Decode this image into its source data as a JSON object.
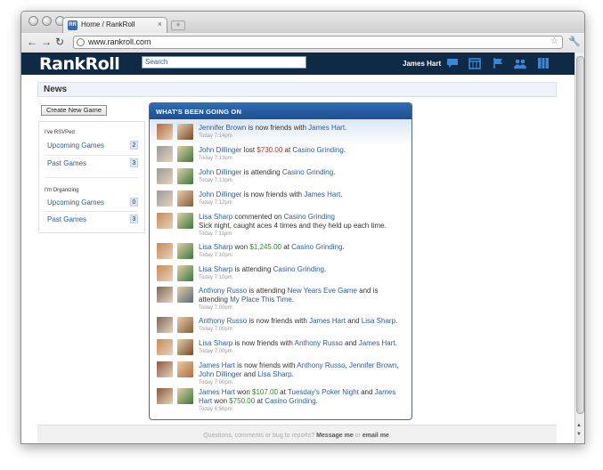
{
  "browser": {
    "tab_title": "Home / RankRoll",
    "tab_favicon": "RR",
    "address": "www.rankroll.com"
  },
  "site": {
    "logo": "RankRoll",
    "search_placeholder": "Search",
    "user_name": "James Hart",
    "header_icons": [
      "chat-bubble-icon",
      "calendar-icon",
      "flag-icon",
      "people-icon",
      "grid-icon"
    ],
    "brand_colors": {
      "header": "#0f2a45",
      "link": "#2a5d99",
      "negative": "#cc2b2b",
      "positive": "#2f8a2f"
    }
  },
  "page": {
    "title": "News",
    "new_game_label": "Create New Game"
  },
  "sidebar": {
    "rsvped": {
      "heading": "I've RSVPed",
      "items": [
        {
          "label": "Upcoming Games",
          "count": "2"
        },
        {
          "label": "Past Games",
          "count": "3"
        }
      ]
    },
    "organizing": {
      "heading": "I'm Organizing",
      "items": [
        {
          "label": "Upcoming Games",
          "count": "0"
        },
        {
          "label": "Past Games",
          "count": "3"
        }
      ]
    }
  },
  "feed": {
    "heading": "WHAT'S BEEN GOING ON",
    "items": [
      {
        "parts": [
          {
            "t": "Jennifer Brown",
            "c": "lk"
          },
          {
            "t": " is now friends with "
          },
          {
            "t": "James Hart",
            "c": "lk"
          },
          {
            "t": "."
          }
        ],
        "time": "Today 7:14pm"
      },
      {
        "parts": [
          {
            "t": "John Dillinger",
            "c": "lk"
          },
          {
            "t": " lost "
          },
          {
            "t": "$730.00",
            "c": "neg"
          },
          {
            "t": " at "
          },
          {
            "t": "Casino Grinding",
            "c": "lk"
          },
          {
            "t": "."
          }
        ],
        "time": "Today 7:13pm"
      },
      {
        "parts": [
          {
            "t": "John Dillinger",
            "c": "lk"
          },
          {
            "t": " is attending "
          },
          {
            "t": "Casino Grinding",
            "c": "lk"
          },
          {
            "t": "."
          }
        ],
        "time": "Today 7:13pm"
      },
      {
        "parts": [
          {
            "t": "John Dillinger",
            "c": "lk"
          },
          {
            "t": " is now friends with "
          },
          {
            "t": "James Hart",
            "c": "lk"
          },
          {
            "t": "."
          }
        ],
        "time": "Today 7:12pm"
      },
      {
        "parts": [
          {
            "t": "Lisa Sharp",
            "c": "lk"
          },
          {
            "t": " commented on "
          },
          {
            "t": "Casino Grinding",
            "c": "lk"
          },
          {
            "t": "\nSick night, caught aces 4 times and they held up each time."
          }
        ],
        "time": "Today 7:11pm"
      },
      {
        "parts": [
          {
            "t": "Lisa Sharp",
            "c": "lk"
          },
          {
            "t": " won "
          },
          {
            "t": "$1,245.00",
            "c": "pos"
          },
          {
            "t": " at "
          },
          {
            "t": "Casino Grinding",
            "c": "lk"
          },
          {
            "t": "."
          }
        ],
        "time": "Today 7:10pm"
      },
      {
        "parts": [
          {
            "t": "Lisa Sharp",
            "c": "lk"
          },
          {
            "t": " is attending "
          },
          {
            "t": "Casino Grinding",
            "c": "lk"
          },
          {
            "t": "."
          }
        ],
        "time": "Today 7:10pm"
      },
      {
        "parts": [
          {
            "t": "Anthony Russo",
            "c": "lk"
          },
          {
            "t": " is attending "
          },
          {
            "t": "New Years Eve Game",
            "c": "lk"
          },
          {
            "t": " and is attending "
          },
          {
            "t": "My Place This Time",
            "c": "lk"
          },
          {
            "t": "."
          }
        ],
        "time": "Today 7:00pm"
      },
      {
        "parts": [
          {
            "t": "Anthony Russo",
            "c": "lk"
          },
          {
            "t": " is now friends with "
          },
          {
            "t": "James Hart",
            "c": "lk"
          },
          {
            "t": " and "
          },
          {
            "t": "Lisa Sharp",
            "c": "lk"
          },
          {
            "t": "."
          }
        ],
        "time": "Today 7:00pm"
      },
      {
        "parts": [
          {
            "t": "Lisa Sharp",
            "c": "lk"
          },
          {
            "t": " is now friends with "
          },
          {
            "t": "Anthony Russo",
            "c": "lk"
          },
          {
            "t": " and "
          },
          {
            "t": "James Hart",
            "c": "lk"
          },
          {
            "t": "."
          }
        ],
        "time": "Today 7:00pm"
      },
      {
        "parts": [
          {
            "t": "James Hart",
            "c": "lk"
          },
          {
            "t": " is now friends with "
          },
          {
            "t": "Anthony Russo",
            "c": "lk"
          },
          {
            "t": ", "
          },
          {
            "t": "Jennifer Brown",
            "c": "lk"
          },
          {
            "t": ", "
          },
          {
            "t": "John Dillinger",
            "c": "lk"
          },
          {
            "t": " and "
          },
          {
            "t": "Lisa Sharp",
            "c": "lk"
          },
          {
            "t": "."
          }
        ],
        "time": "Today 7:00pm"
      },
      {
        "parts": [
          {
            "t": "James Hart",
            "c": "lk"
          },
          {
            "t": " won "
          },
          {
            "t": "$107.00",
            "c": "pos"
          },
          {
            "t": " at "
          },
          {
            "t": "Tuesday's Poker Night",
            "c": "lk"
          },
          {
            "t": " and "
          },
          {
            "t": "James Hart",
            "c": "lk"
          },
          {
            "t": " won "
          },
          {
            "t": "$750.00",
            "c": "pos"
          },
          {
            "t": " at "
          },
          {
            "t": "Casino Grinding",
            "c": "lk"
          },
          {
            "t": "."
          }
        ],
        "time": "Today 6:56pm"
      }
    ]
  },
  "footer": {
    "text_before": "Questions, comments or bug to reports? ",
    "link1": "Message me",
    "text_mid": " or ",
    "link2": "email me",
    "text_after": "."
  }
}
